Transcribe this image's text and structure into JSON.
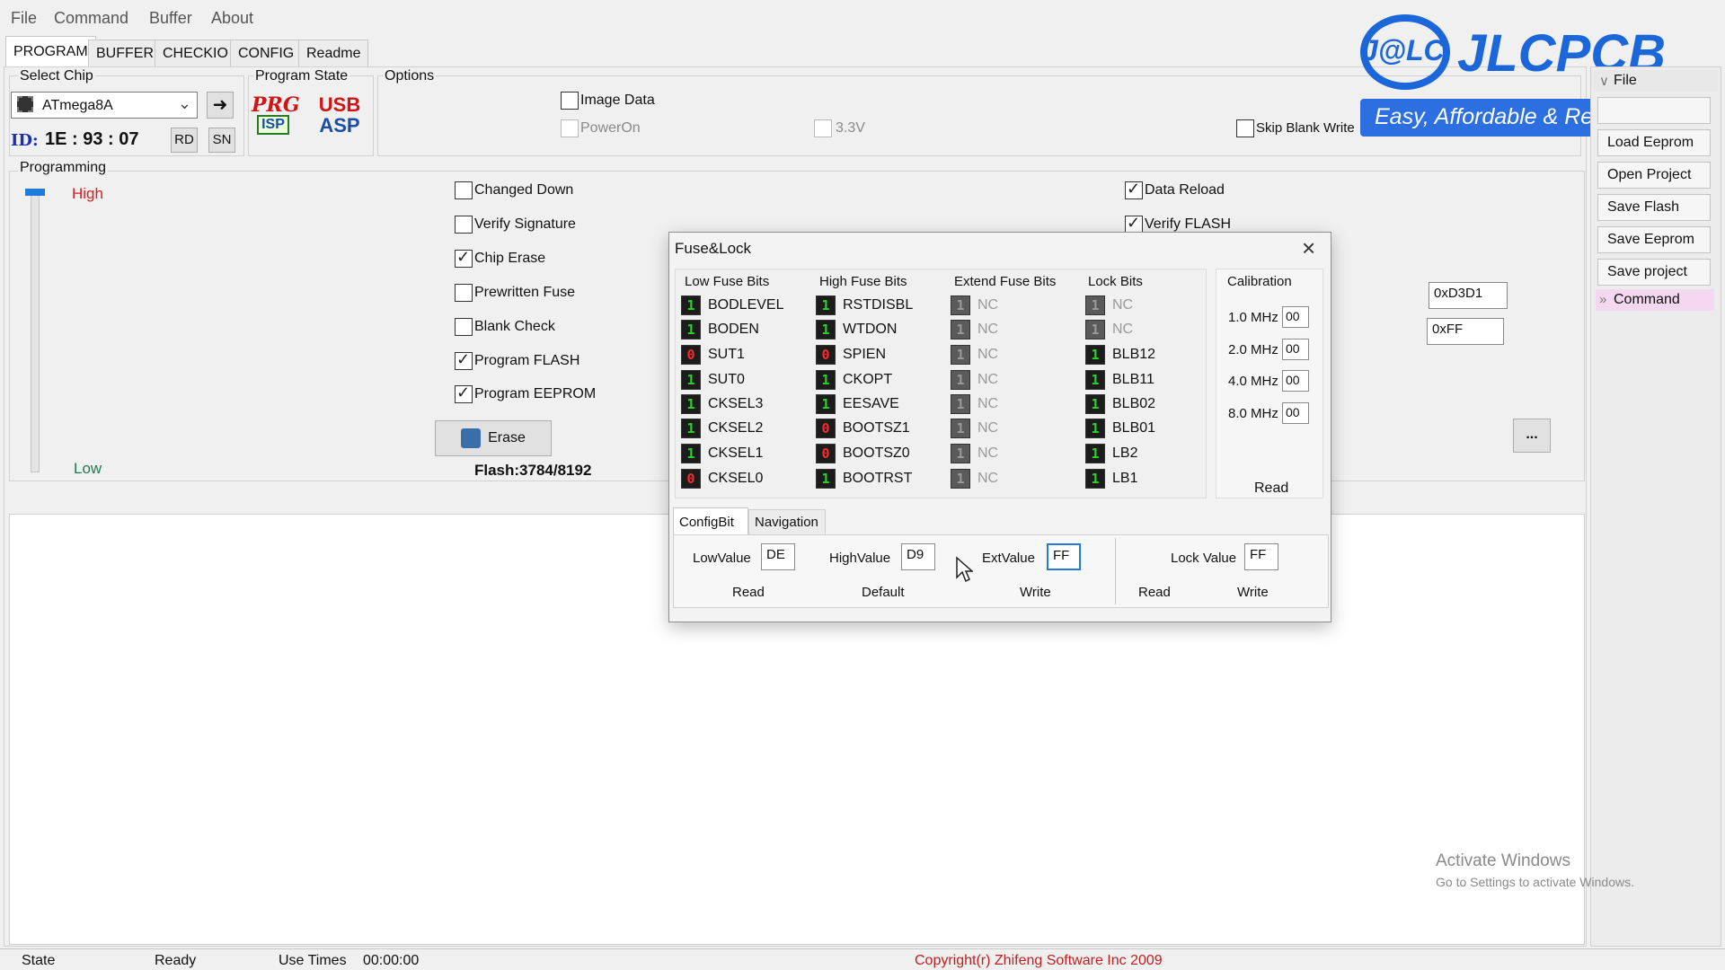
{
  "menu": [
    "File",
    "Command",
    "Buffer",
    "About"
  ],
  "tabs": [
    "PROGRAM",
    "BUFFER",
    "CHECKIO",
    "CONFIG",
    "Readme"
  ],
  "select_chip": {
    "title": "Select Chip",
    "chip": "ATmega8A",
    "id_label": "ID:",
    "id_value": "1E : 93 : 07",
    "rd": "RD",
    "sn": "SN"
  },
  "program_state": {
    "title": "Program State",
    "prg_top": "PRG",
    "prg_bottom": "ISP",
    "usb_top": "USB",
    "usb_bottom": "ASP"
  },
  "options": {
    "title": "Options",
    "image_data": {
      "label": "Image Data",
      "checked": false
    },
    "power_on": {
      "label": "PowerOn",
      "checked": false
    },
    "v33": {
      "label": "3.3V",
      "checked": false
    },
    "skip_blank": {
      "label": "Skip Blank Write",
      "checked": false
    }
  },
  "brand": {
    "logo_text": "JLCPCB",
    "logo_mark": "J@LC",
    "tagline": "Easy, Affordable & Reliable"
  },
  "programming": {
    "title": "Programming",
    "high": "High",
    "low": "Low",
    "checks": [
      {
        "label": "Changed Down",
        "checked": false
      },
      {
        "label": "Verify Signature",
        "checked": false
      },
      {
        "label": "Chip Erase",
        "checked": true
      },
      {
        "label": "Prewritten Fuse",
        "checked": false
      },
      {
        "label": "Blank Check",
        "checked": false
      },
      {
        "label": "Program FLASH",
        "checked": true
      },
      {
        "label": "Program EEPROM",
        "checked": true
      }
    ],
    "right_checks": [
      {
        "label": "Data Reload",
        "checked": true
      },
      {
        "label": "Verify FLASH",
        "checked": true
      }
    ],
    "erase": "Erase",
    "flash_info": "Flash:3784/8192",
    "hex1": "0xD3D1",
    "hex2": "0xFF",
    "more": "..."
  },
  "sidebar": {
    "file_header": "File",
    "buttons": [
      "",
      "Load Eeprom",
      "Open Project",
      "Save Flash",
      "Save Eeprom",
      "Save project"
    ],
    "command_header": "Command"
  },
  "activate": {
    "line1": "Activate Windows",
    "line2": "Go to Settings to activate Windows."
  },
  "status": {
    "state_label": "State",
    "state_value": "Ready",
    "use_times_label": "Use Times",
    "use_times_value": "00:00:00",
    "copyright": "Copyright(r) Zhifeng Software Inc 2009"
  },
  "dialog": {
    "title": "Fuse&Lock",
    "low_title": "Low Fuse Bits",
    "high_title": "High Fuse Bits",
    "ext_title": "Extend Fuse Bits",
    "lock_title": "Lock Bits",
    "cal_title": "Calibration",
    "low_bits": [
      {
        "v": "1",
        "name": "BODLEVEL"
      },
      {
        "v": "1",
        "name": "BODEN"
      },
      {
        "v": "0",
        "name": "SUT1"
      },
      {
        "v": "1",
        "name": "SUT0"
      },
      {
        "v": "1",
        "name": "CKSEL3"
      },
      {
        "v": "1",
        "name": "CKSEL2"
      },
      {
        "v": "1",
        "name": "CKSEL1"
      },
      {
        "v": "0",
        "name": "CKSEL0"
      }
    ],
    "high_bits": [
      {
        "v": "1",
        "name": "RSTDISBL"
      },
      {
        "v": "1",
        "name": "WTDON"
      },
      {
        "v": "0",
        "name": "SPIEN"
      },
      {
        "v": "1",
        "name": "CKOPT"
      },
      {
        "v": "1",
        "name": "EESAVE"
      },
      {
        "v": "0",
        "name": "BOOTSZ1"
      },
      {
        "v": "0",
        "name": "BOOTSZ0"
      },
      {
        "v": "1",
        "name": "BOOTRST"
      }
    ],
    "ext_bits": [
      {
        "v": "1",
        "name": "NC"
      },
      {
        "v": "1",
        "name": "NC"
      },
      {
        "v": "1",
        "name": "NC"
      },
      {
        "v": "1",
        "name": "NC"
      },
      {
        "v": "1",
        "name": "NC"
      },
      {
        "v": "1",
        "name": "NC"
      },
      {
        "v": "1",
        "name": "NC"
      },
      {
        "v": "1",
        "name": "NC"
      }
    ],
    "lock_bits": [
      {
        "v": "1",
        "name": "NC",
        "nc": true
      },
      {
        "v": "1",
        "name": "NC",
        "nc": true
      },
      {
        "v": "1",
        "name": "BLB12"
      },
      {
        "v": "1",
        "name": "BLB11"
      },
      {
        "v": "1",
        "name": "BLB02"
      },
      {
        "v": "1",
        "name": "BLB01"
      },
      {
        "v": "1",
        "name": "LB2"
      },
      {
        "v": "1",
        "name": "LB1"
      }
    ],
    "calibration": [
      {
        "freq": "1.0 MHz",
        "value": "00"
      },
      {
        "freq": "2.0 MHz",
        "value": "00"
      },
      {
        "freq": "4.0 MHz",
        "value": "00"
      },
      {
        "freq": "8.0 MHz",
        "value": "00"
      }
    ],
    "cal_read": "Read",
    "tab_configbit": "ConfigBit",
    "tab_navigation": "Navigation",
    "low_value_label": "LowValue",
    "low_value": "DE",
    "high_value_label": "HighValue",
    "high_value": "D9",
    "ext_value_label": "ExtValue",
    "ext_value": "FF",
    "lock_value_label": "Lock Value",
    "lock_value": "FF",
    "read": "Read",
    "default": "Default",
    "write": "Write",
    "lock_read": "Read",
    "lock_write": "Write"
  }
}
